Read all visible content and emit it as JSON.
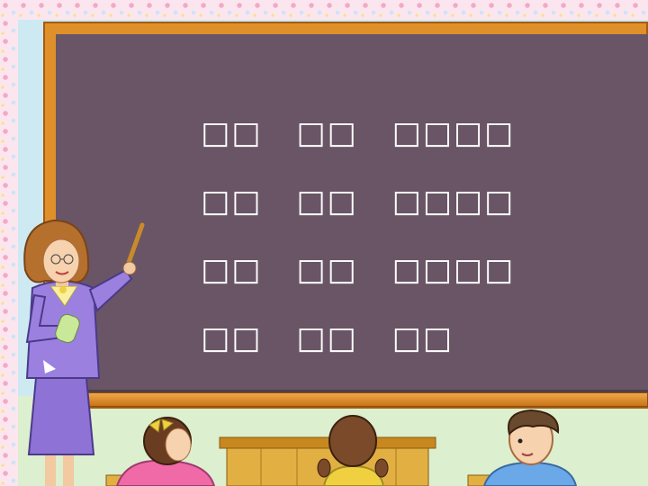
{
  "board": {
    "lines": [
      [
        "□□",
        "□□",
        "□□□□"
      ],
      [
        "□□",
        "□□",
        "□□□□"
      ],
      [
        "□□",
        "□□",
        "□□□□"
      ],
      [
        "□□",
        "□□",
        "□□"
      ]
    ]
  },
  "colors": {
    "chalkboard": "#695565",
    "frame": "#e0902a",
    "chalk_text": "#ffffff",
    "teacher_suit": "#8f72d6",
    "wall": "#cdeaf3"
  },
  "icons": [
    "teacher-figure",
    "pointer-stick",
    "student-girl-left",
    "student-girl-center",
    "student-boy-right",
    "desk"
  ]
}
